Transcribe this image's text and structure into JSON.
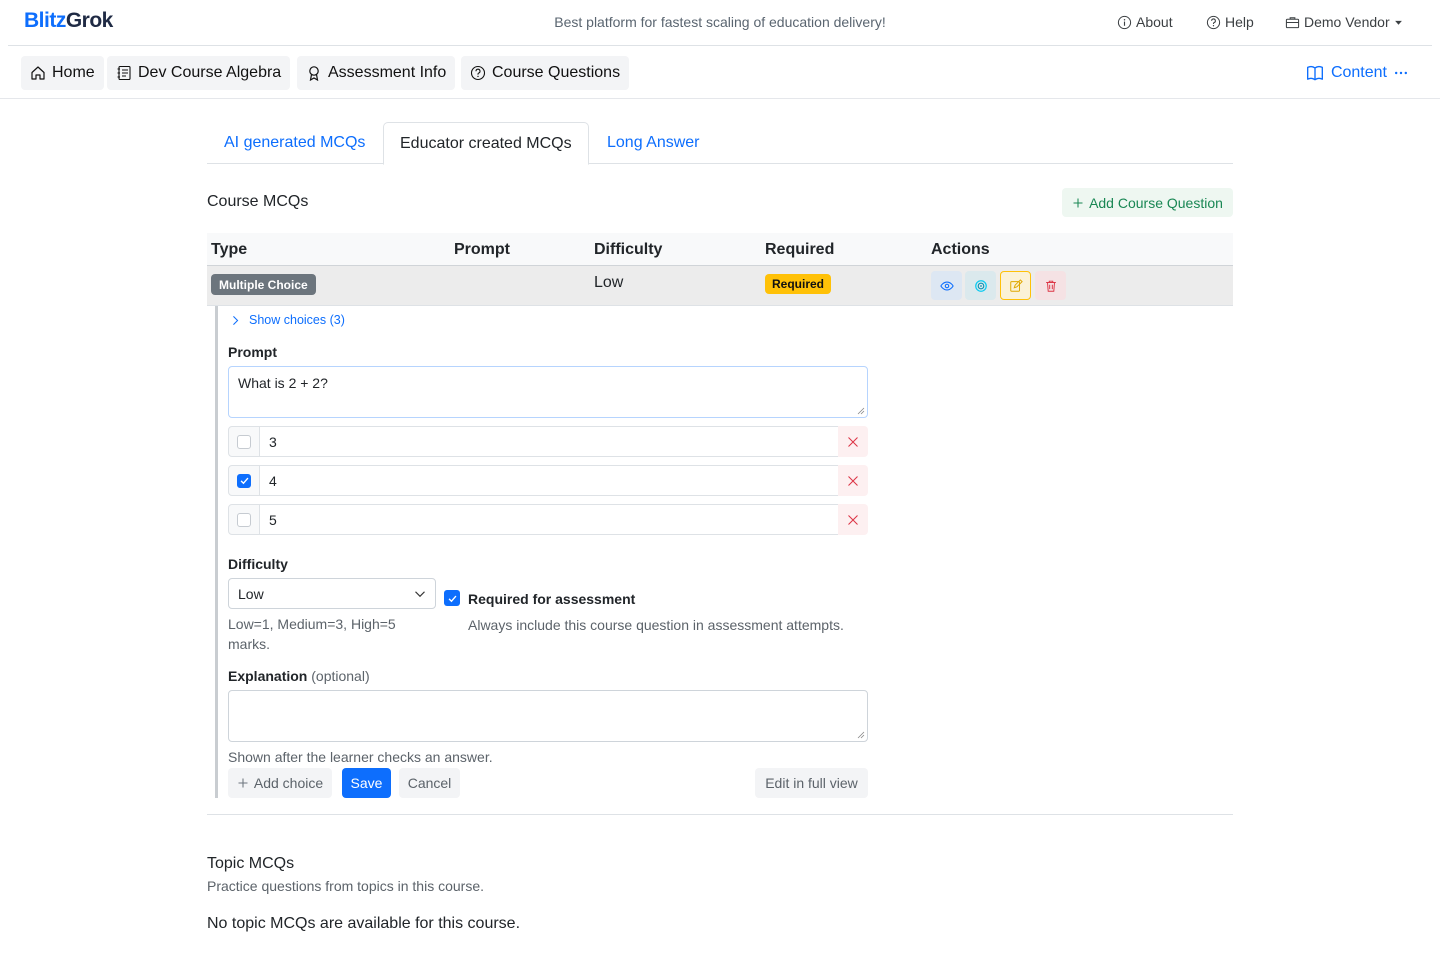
{
  "header": {
    "brand_part1": "Blitz",
    "brand_part2": "Grok",
    "tagline": "Best platform for fastest scaling of education delivery!",
    "about": "About",
    "help": "Help",
    "vendor": "Demo Vendor"
  },
  "nav": {
    "crumbs": [
      "Home",
      "Dev Course Algebra",
      "Assessment Info",
      "Course Questions"
    ],
    "content": "Content"
  },
  "tabs": [
    "AI generated MCQs",
    "Educator created MCQs",
    "Long Answer"
  ],
  "course_mcqs": {
    "title": "Course MCQs",
    "add_button": "Add Course Question",
    "columns": [
      "Type",
      "Prompt",
      "Difficulty",
      "Required",
      "Actions"
    ],
    "row": {
      "type": "Multiple Choice",
      "prompt": "",
      "difficulty": "Low",
      "required": "Required",
      "actions": [
        "view-icon",
        "target-icon",
        "edit-icon",
        "trash-icon"
      ]
    }
  },
  "editor": {
    "show_choices": "Show choices (3)",
    "prompt_label": "Prompt",
    "prompt_value": "What is 2 + 2?",
    "choices": [
      {
        "value": "3",
        "checked": false
      },
      {
        "value": "4",
        "checked": true
      },
      {
        "value": "5",
        "checked": false
      }
    ],
    "difficulty_label": "Difficulty",
    "difficulty_value": "Low",
    "difficulty_help": "Low=1, Medium=3, High=5 marks.",
    "required_label": "Required for assessment",
    "required_checked": true,
    "required_help": "Always include this course question in assessment attempts.",
    "explanation_label": "Explanation",
    "explanation_optional": "(optional)",
    "explanation_value": "",
    "explanation_help": "Shown after the learner checks an answer.",
    "add_choice": "Add choice",
    "save": "Save",
    "cancel": "Cancel",
    "full_view": "Edit in full view"
  },
  "topic_mcqs": {
    "title": "Topic MCQs",
    "subtitle": "Practice questions from topics in this course.",
    "empty": "No topic MCQs are available for this course."
  },
  "colors": {
    "primary": "#0d6efd",
    "success": "#198754",
    "warning": "#ffc107",
    "danger": "#dc3545",
    "secondary": "#6c757d"
  }
}
